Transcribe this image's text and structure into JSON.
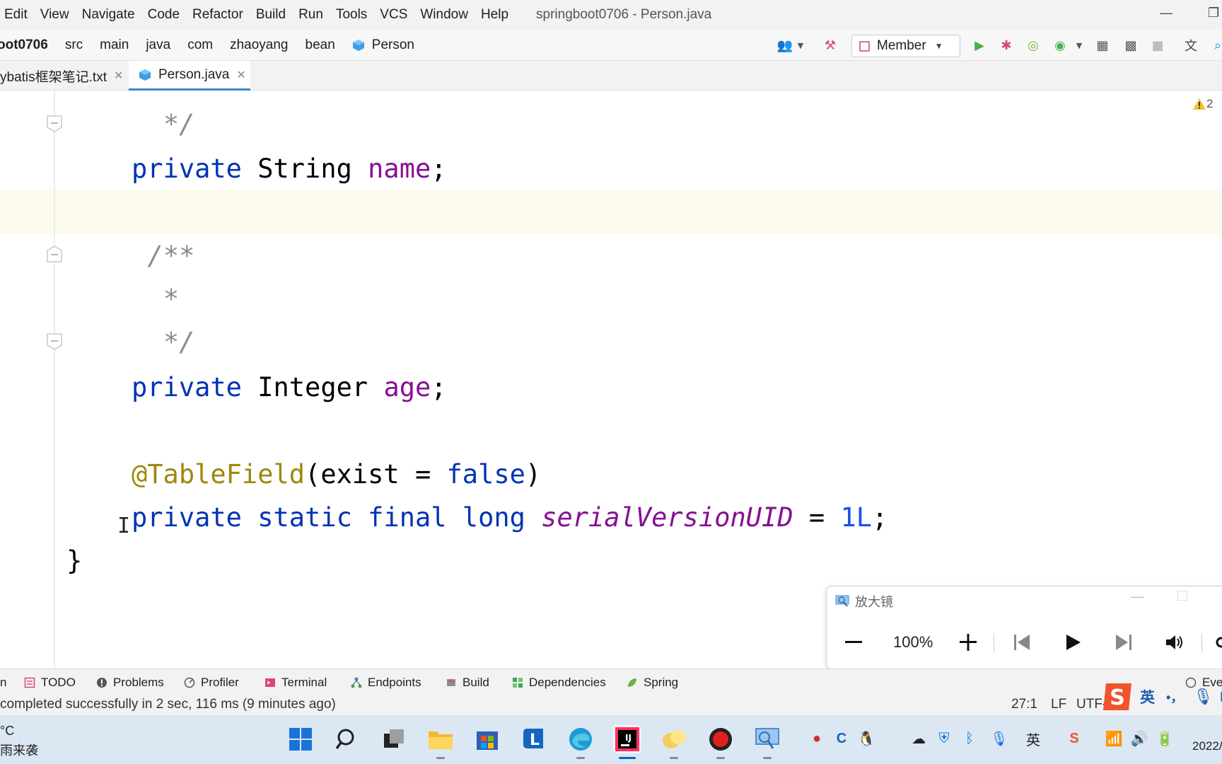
{
  "menu": {
    "items": [
      "Edit",
      "View",
      "Navigate",
      "Code",
      "Refactor",
      "Build",
      "Run",
      "Tools",
      "VCS",
      "Window",
      "Help"
    ],
    "window_title": "springboot0706 - Person.java"
  },
  "breadcrumb": {
    "items": [
      "oot0706",
      "src",
      "main",
      "java",
      "com",
      "zhaoyang",
      "bean",
      "Person"
    ]
  },
  "run_config": {
    "label": "Member"
  },
  "tabs": [
    {
      "label": "ybatis框架笔记.txt",
      "active": false
    },
    {
      "label": "Person.java",
      "active": true
    }
  ],
  "editor": {
    "warnings": "2",
    "lines": [
      {
        "tokens": [
          {
            "t": "cmt",
            "v": "   */"
          }
        ]
      },
      {
        "tokens": [
          {
            "t": "kw",
            "v": "private "
          },
          {
            "t": "type",
            "v": "String "
          },
          {
            "t": "field",
            "v": "name"
          },
          {
            "t": "type",
            "v": ";"
          }
        ]
      },
      {
        "tokens": [
          {
            "t": "cmt",
            "v": "  /**"
          }
        ]
      },
      {
        "tokens": [
          {
            "t": "cmt",
            "v": "   *"
          }
        ]
      },
      {
        "tokens": [
          {
            "t": "cmt",
            "v": "   */"
          }
        ]
      },
      {
        "tokens": [
          {
            "t": "kw",
            "v": "private "
          },
          {
            "t": "type",
            "v": "Integer "
          },
          {
            "t": "field",
            "v": "age"
          },
          {
            "t": "type",
            "v": ";"
          }
        ]
      },
      {
        "tokens": [
          {
            "t": "ann",
            "v": "@TableField"
          },
          {
            "t": "type",
            "v": "(exist = "
          },
          {
            "t": "kw",
            "v": "false"
          },
          {
            "t": "type",
            "v": ")"
          }
        ]
      },
      {
        "tokens": [
          {
            "t": "kw",
            "v": "private static final long "
          },
          {
            "t": "sfield",
            "v": "serialVersionUID"
          },
          {
            "t": "type",
            "v": " = "
          },
          {
            "t": "num",
            "v": "1L"
          },
          {
            "t": "type",
            "v": ";"
          }
        ]
      },
      {
        "tokens": [
          {
            "t": "type",
            "v": "}"
          }
        ]
      }
    ]
  },
  "magnifier": {
    "title": "放大镜",
    "zoom": "100%"
  },
  "tool_windows": [
    "n",
    "TODO",
    "Problems",
    "Profiler",
    "Terminal",
    "Endpoints",
    "Build",
    "Dependencies",
    "Spring",
    "Eve"
  ],
  "status": {
    "message": "completed successfully in 2 sec, 116 ms (9 minutes ago)",
    "caret": "27:1",
    "line_separator": "LF",
    "encoding": "UTF-"
  },
  "ime": {
    "lang": "英",
    "punct": "•，"
  },
  "taskbar": {
    "weather_temp": "°C",
    "weather_desc": "雨来袭",
    "tray_lang": "英",
    "clock_year": "2022/"
  }
}
